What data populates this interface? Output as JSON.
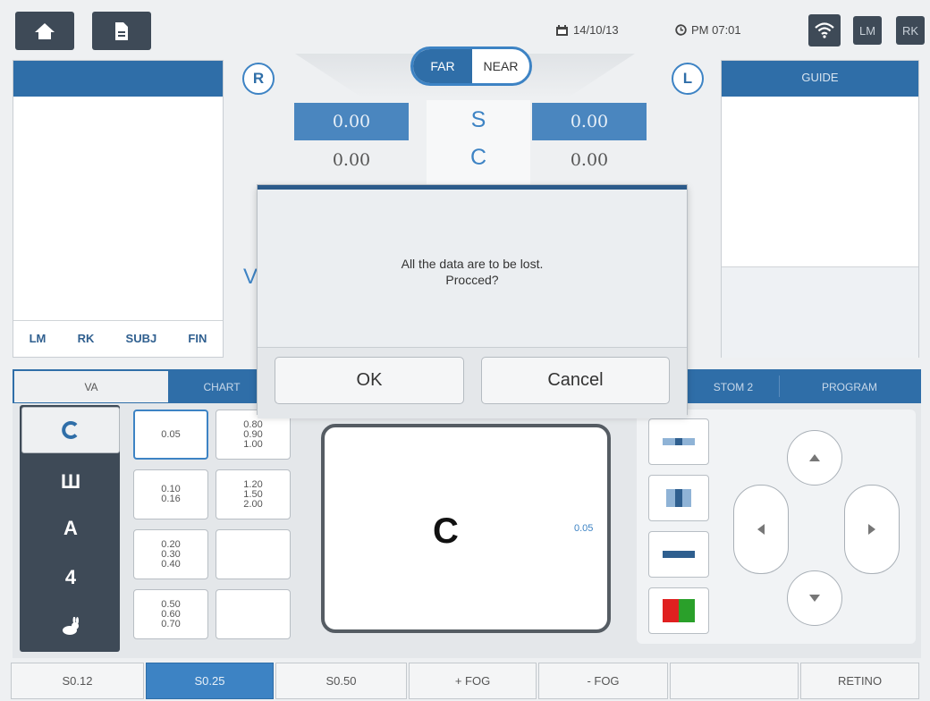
{
  "header": {
    "date": "14/10/13",
    "time": "PM 07:01",
    "lm_label": "LM",
    "rk_label": "RK"
  },
  "mode": {
    "far": "FAR",
    "near": "NEAR",
    "selected": "FAR"
  },
  "eyes": {
    "right": "R",
    "left": "L"
  },
  "measurements": {
    "s_label": "S",
    "c_label": "C",
    "right_s": "0.00",
    "right_c": "0.00",
    "left_s": "0.00",
    "left_c": "0.00",
    "partial_label": "V"
  },
  "left_panel": {
    "tabs": [
      "LM",
      "RK",
      "SUBJ",
      "FIN"
    ]
  },
  "guide_panel": {
    "title": "GUIDE"
  },
  "tabs": {
    "va": "VA",
    "chart": "CHART",
    "custom2": "STOM 2",
    "program": "PROGRAM"
  },
  "va_values": [
    {
      "id": "a",
      "text": "0.05"
    },
    {
      "id": "b",
      "text": "0.80\n0.90\n1.00"
    },
    {
      "id": "c",
      "text": "0.10\n0.16"
    },
    {
      "id": "d",
      "text": "1.20\n1.50\n2.00"
    },
    {
      "id": "e",
      "text": "0.20\n0.30\n0.40"
    },
    {
      "id": "f",
      "text": ""
    },
    {
      "id": "g",
      "text": "0.50\n0.60\n0.70"
    },
    {
      "id": "h",
      "text": ""
    }
  ],
  "optotypes": {
    "landolt": "O",
    "e_chart": "Ш",
    "letter": "A",
    "number": "4",
    "picture": "rabbit-icon"
  },
  "display": {
    "symbol": "C",
    "value": "0.05"
  },
  "bottom_buttons": [
    "S0.12",
    "S0.25",
    "S0.50",
    "+ FOG",
    "- FOG",
    "",
    "RETINO"
  ],
  "dialog": {
    "message_line1": "All the data are to be lost.",
    "message_line2": "Procced?",
    "ok": "OK",
    "cancel": "Cancel"
  },
  "colors": {
    "accent": "#2f6ea8",
    "dark": "#3e4a57",
    "value_box": "#4a86bf"
  }
}
